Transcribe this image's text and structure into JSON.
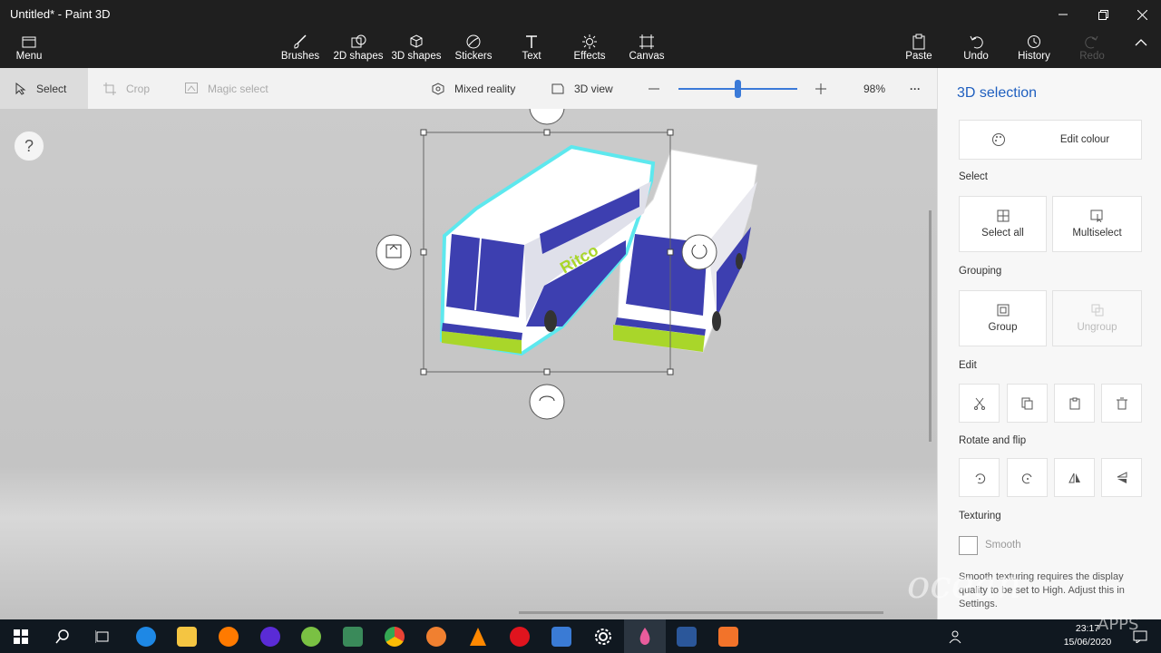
{
  "window": {
    "title": "Untitled* - Paint 3D"
  },
  "ribbon": {
    "menu": "Menu",
    "tools": [
      "Brushes",
      "2D shapes",
      "3D shapes",
      "Stickers",
      "Text",
      "Effects",
      "Canvas"
    ],
    "paste": "Paste",
    "undo": "Undo",
    "history": "History",
    "redo": "Redo"
  },
  "toolbar": {
    "select": "Select",
    "crop": "Crop",
    "magic_select": "Magic select",
    "mixed_reality": "Mixed reality",
    "view_3d": "3D view",
    "zoom": "98%",
    "zoom_fraction": 0.5,
    "more": "···"
  },
  "canvas": {
    "help": "?",
    "object_text": "Ritco"
  },
  "panel": {
    "title": "3D selection",
    "edit_colour": "Edit colour",
    "select_label": "Select",
    "select_all": "Select all",
    "multiselect": "Multiselect",
    "grouping_label": "Grouping",
    "group": "Group",
    "ungroup": "Ungroup",
    "edit_label": "Edit",
    "rotate_label": "Rotate and flip",
    "texturing_label": "Texturing",
    "smooth": "Smooth",
    "note": "Smooth texturing requires the display quality to be set to High. Adjust this in Settings."
  },
  "taskbar": {
    "time": "23:17",
    "date": "15/06/2020"
  },
  "watermark": {
    "text": "ocean",
    "sub": "APPS"
  }
}
